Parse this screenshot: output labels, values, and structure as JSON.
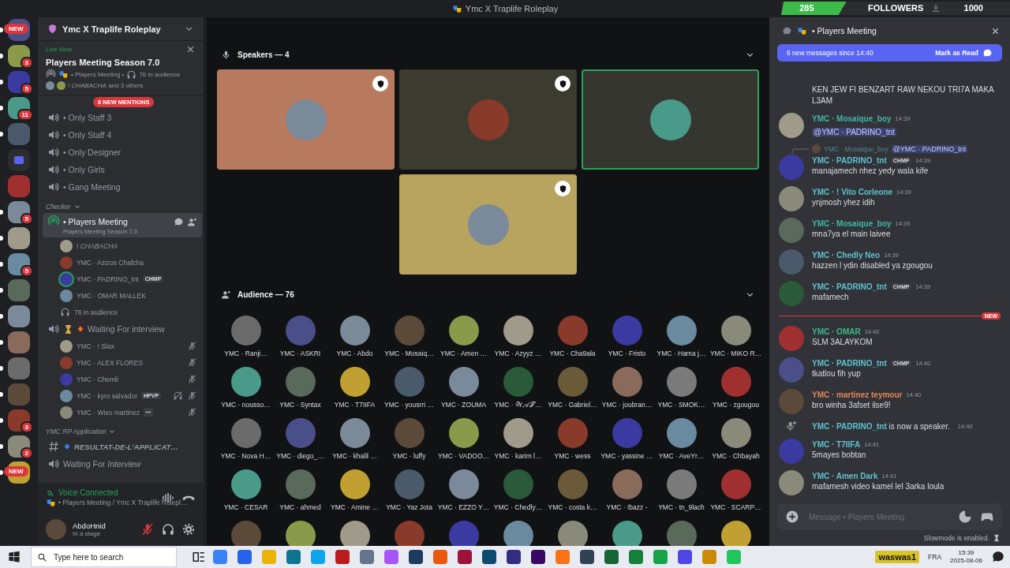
{
  "window": {
    "title": "Ymc X Traplife Roleplay"
  },
  "followers_overlay": {
    "current": "285",
    "label": "FOLLOWERS",
    "goal": "1000",
    "level": 0.285
  },
  "servers": [
    {
      "kind": "server",
      "pill": "NEW",
      "unread": true
    },
    {
      "kind": "server",
      "badge": "3",
      "unread": true
    },
    {
      "kind": "server",
      "badge": "5",
      "unread": true
    },
    {
      "kind": "server",
      "badge": "11",
      "unread": true
    },
    {
      "kind": "server",
      "unread": true
    },
    {
      "kind": "folder",
      "unread": false
    },
    {
      "kind": "server",
      "unread": false
    },
    {
      "kind": "server",
      "badge": "5",
      "unread": true
    },
    {
      "kind": "server",
      "unread": true
    },
    {
      "kind": "server",
      "badge": "5",
      "unread": true
    },
    {
      "kind": "server",
      "unread": true
    },
    {
      "kind": "server",
      "unread": true
    },
    {
      "kind": "server",
      "unread": true
    },
    {
      "kind": "server",
      "unread": true
    },
    {
      "kind": "server",
      "unread": true
    },
    {
      "kind": "server",
      "badge": "3",
      "unread": true
    },
    {
      "kind": "server",
      "badge": "2",
      "unread": true
    },
    {
      "kind": "server",
      "pill": "NEW",
      "unread": true
    }
  ],
  "server_header": {
    "name": "Ymc X Traplife Roleplay"
  },
  "live_banner": {
    "status": "Live Now",
    "title": "Players Meeting Season 7.0",
    "channel": "• Players Meeting •",
    "audience": "76 in audience",
    "speakers": "! *CHABACHA* and 3 others"
  },
  "mentions_pill": "6 NEW MENTIONS",
  "channels": [
    {
      "kind": "voice",
      "name": "• Only Staff 3",
      "selected": false
    },
    {
      "kind": "voice",
      "name": "• Only Staff 4",
      "selected": false
    },
    {
      "kind": "voice",
      "name": "• Only Designer",
      "selected": false
    },
    {
      "kind": "voice",
      "name": "• Only Girls",
      "selected": false
    },
    {
      "kind": "voice",
      "name": "• Gang Meeting",
      "selected": false
    },
    {
      "kind": "category",
      "name": "Checker",
      "children": [
        {
          "kind": "stage",
          "name": "• Players Meeting",
          "subtitle": "Players Meeting Season 7.0",
          "selected": true,
          "audience": "76 in audience",
          "children": [
            {
              "name": "! *CHABACHA*",
              "speaking": false,
              "muted": false,
              "deafened": false
            },
            {
              "name": "YMC · Azizos Chafcha",
              "speaking": false,
              "muted": false,
              "deafened": false
            },
            {
              "name": "YMC · PADRINO_tnt",
              "badge": "CHMP",
              "speaking": true,
              "muted": false,
              "deafened": false
            },
            {
              "name": "YMC · OMAR MALLEK",
              "speaking": false,
              "muted": false,
              "deafened": false
            }
          ]
        },
        {
          "kind": "voice",
          "name": "Waiting For interview",
          "selected": false,
          "children": [
            {
              "name": "YMC · ! Slax",
              "speaking": false,
              "muted": true,
              "deafened": false
            },
            {
              "name": "YMC · ALEX FLORES",
              "speaking": false,
              "muted": true,
              "deafened": false
            },
            {
              "name": "YMC · Chemli",
              "speaking": false,
              "muted": true,
              "deafened": false
            },
            {
              "name": "YMC · kyro salvador",
              "badge": "HPVP",
              "speaking": false,
              "muted": true,
              "deafened": true
            },
            {
              "name": "YMC · Wixo martinez",
              "badge": "ꟷ",
              "speaking": false,
              "muted": true,
              "deafened": false
            }
          ]
        }
      ]
    },
    {
      "kind": "category",
      "name": "YMC RP Application",
      "children": [
        {
          "kind": "text",
          "name": "RESULTAT-DE-L'APPLICAT…",
          "selected": false
        },
        {
          "kind": "voice",
          "name": "Waiting For *Interview*",
          "selected": false
        }
      ]
    }
  ],
  "voice_panel": {
    "status": "Voice Connected",
    "location": "• Players Meeting / Ymc X Traplife Rolepl…"
  },
  "user_panel": {
    "name": "AbdoHnid",
    "status": "In a stage",
    "mic_muted": true
  },
  "stage": {
    "speakers_label": "Speakers — 4",
    "audience_label": "Audience — 76",
    "speakers": [
      {
        "color": "#b87a5e",
        "moderator": true,
        "speaking": false
      },
      {
        "color": "#3b3b30",
        "moderator": true,
        "speaking": false
      },
      {
        "color": "#363630",
        "moderator": false,
        "speaking": true
      },
      {
        "color": "#b9a45f",
        "moderator": true,
        "speaking": false
      }
    ],
    "audience": [
      {
        "name": "YMC · Ranji…"
      },
      {
        "name": "YMC · ASKRI"
      },
      {
        "name": "YMC · Abdo"
      },
      {
        "name": "YMC · Mosaiq…"
      },
      {
        "name": "YMC · Amen …"
      },
      {
        "name": "YMC · Azyyz …"
      },
      {
        "name": "YMC · Cha9ala"
      },
      {
        "name": "YMC · Fristo"
      },
      {
        "name": "YMC · Hama j…"
      },
      {
        "name": "YMC · MIKO R…"
      },
      {
        "name": "YMC · nousso…"
      },
      {
        "name": "YMC · Syntax"
      },
      {
        "name": "YMC · T7IIFA"
      },
      {
        "name": "YMC · yousrri …"
      },
      {
        "name": "YMC · ZOUMA"
      },
      {
        "name": "YMC · 𝒲𝒜𝒮…"
      },
      {
        "name": "YMC · Gabriel…"
      },
      {
        "name": "YMC · joubran…"
      },
      {
        "name": "YMC · SMOK…"
      },
      {
        "name": "YMC · zgougou"
      },
      {
        "name": "YMC · Nova H…"
      },
      {
        "name": "YMC · diego_…"
      },
      {
        "name": "YMC · khalil …"
      },
      {
        "name": "YMC · luffy"
      },
      {
        "name": "YMC · VADOO…"
      },
      {
        "name": "YMC · karim l…"
      },
      {
        "name": "YMC · wess"
      },
      {
        "name": "YMC · yassine …"
      },
      {
        "name": "YMC · AveYr…"
      },
      {
        "name": "YMC · Chbayah"
      },
      {
        "name": "YMC · CESAR"
      },
      {
        "name": "YMC · ahmed"
      },
      {
        "name": "YMC · Amine …"
      },
      {
        "name": "YMC · Yaz Jota"
      },
      {
        "name": "YMC · EZZO Y…"
      },
      {
        "name": "YMC · Chedly…"
      },
      {
        "name": "YMC · costa k…"
      },
      {
        "name": "YMC · !bazz -"
      },
      {
        "name": "YMC · tn_9lach"
      },
      {
        "name": "YMC · SCARP…"
      }
    ]
  },
  "chat": {
    "title": "• Players Meeting",
    "banner": "6 new messages since 14:40",
    "mark_read": "Mark as Read",
    "messages": [
      {
        "kind": "continuation",
        "text": "KEN JEW FI BENZART RAW NEKOU TRI7A MAKA L3AM"
      },
      {
        "kind": "message",
        "author": "YMC · Mosaique_boy",
        "color": "#3fb8a8",
        "time": "14:39",
        "mention": "@YMC · PADRINO_tnt"
      },
      {
        "kind": "message",
        "reply_author": "YMC · Mosaique_boy",
        "reply_mention": "@YMC · PADRINO_tnt",
        "author": "YMC · PADRINO_tnt",
        "color": "#5fc2d0",
        "badge": "CHMP",
        "time": "14:39",
        "text": "manajamech nhez yedy wala kife"
      },
      {
        "kind": "message",
        "author": "YMC · ! Vito Corleone",
        "color": "#5fc2d0",
        "time": "14:39",
        "text": "ynjmosh yhez idih"
      },
      {
        "kind": "message",
        "author": "YMC · Mosaique_boy",
        "color": "#3fb8a8",
        "time": "14:39",
        "text": "mna7ya el main laivee"
      },
      {
        "kind": "message",
        "author": "YMC · Chedly Neo",
        "color": "#5fc2d0",
        "time": "14:39",
        "text": "hazzen l ydin disabled ya zgougou"
      },
      {
        "kind": "message",
        "author": "YMC · PADRINO_tnt",
        "color": "#5fc2d0",
        "badge": "CHMP",
        "time": "14:39",
        "text": "mafamech"
      },
      {
        "kind": "divider",
        "label": "NEW"
      },
      {
        "kind": "message",
        "author": "YMC · OMAR",
        "color": "#3fb88a",
        "time": "14:40",
        "text": "SLM 3ALAYKOM"
      },
      {
        "kind": "message",
        "author": "YMC · PADRINO_tnt",
        "color": "#5fc2d0",
        "badge": "CHMP",
        "time": "14:40",
        "text": "tkatlou fih yup"
      },
      {
        "kind": "message",
        "author": "YMC · martinez teymour",
        "color": "#e0875a",
        "time": "14:40",
        "text": "bro winha 3afset ilse9!"
      },
      {
        "kind": "system",
        "author": "YMC · PADRINO_tnt",
        "color": "#5fc2d0",
        "text": " is now a speaker.",
        "time": "14:40"
      },
      {
        "kind": "message",
        "author": "YMC · T7IIFA",
        "color": "#5fc2d0",
        "time": "14:41",
        "text": "5mayes bobtan"
      },
      {
        "kind": "message",
        "author": "YMC · Amen Dark",
        "color": "#5fc2d0",
        "time": "14:41",
        "text": "mafamesh video kamel lel 3arka loula"
      }
    ],
    "composer": {
      "placeholder": "Message • Players Meeting"
    },
    "slowmode": "Slowmode is enabled."
  },
  "taskbar": {
    "search_placeholder": "Type here to search",
    "highlight": "waswas1",
    "language": "FRA",
    "time": "15:39",
    "date": "2025-08-06"
  }
}
